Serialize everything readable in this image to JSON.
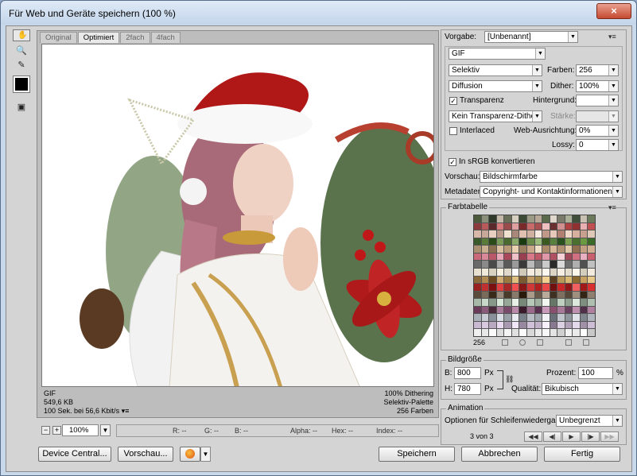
{
  "window": {
    "title": "Für Web und Geräte speichern (100 %)",
    "close_glyph": "×"
  },
  "tools": [
    {
      "name": "hand-tool-icon",
      "glyph": "✋",
      "selected": true
    },
    {
      "name": "slice-select-tool-icon",
      "glyph": "⤡",
      "selected": false
    },
    {
      "name": "zoom-tool-icon",
      "glyph": "🔍",
      "selected": false
    },
    {
      "name": "eyedropper-tool-icon",
      "glyph": "✎",
      "selected": false
    },
    {
      "name": "toggle-slices-icon",
      "glyph": "▣",
      "selected": false
    }
  ],
  "eyedropper_color": "#000000",
  "preview": {
    "tabs": [
      "Original",
      "Optimiert",
      "2fach",
      "4fach"
    ],
    "active_tab": 1,
    "info_left": [
      "GIF",
      "549,6 KB",
      "100 Sek. bei 56,6 Kbit/s"
    ],
    "info_menu_glyph": "▾≡",
    "info_right": [
      "100% Dithering",
      "Selektiv-Palette",
      "256 Farben"
    ]
  },
  "status": {
    "zoom_minus": "−",
    "zoom_plus": "+",
    "zoom": "100%",
    "readouts": [
      "R: --",
      "G: --",
      "B: --",
      "Alpha: --",
      "Hex: --",
      "Index: --"
    ]
  },
  "buttons": {
    "device_central": "Device Central...",
    "preview": "Vorschau...",
    "save": "Speichern",
    "cancel": "Abbrechen",
    "done": "Fertig"
  },
  "settings": {
    "preset_label": "Vorgabe:",
    "preset_value": "[Unbenannt]",
    "format": "GIF",
    "reduction": "Selektiv",
    "colors_label": "Farben:",
    "colors": "256",
    "dither_algo": "Diffusion",
    "dither_label": "Dither:",
    "dither": "100%",
    "transparency_label": "Transparenz",
    "transparency_checked": true,
    "matte_label": "Hintergrund:",
    "matte_value": "",
    "transparency_dither": "Kein Transparenz-Dither",
    "amount_label": "Stärke:",
    "amount_value": "",
    "interlaced_label": "Interlaced",
    "interlaced_checked": false,
    "websnap_label": "Web-Ausrichtung:",
    "websnap": "0%",
    "lossy_label": "Lossy:",
    "lossy": "0",
    "srgb_label": "In sRGB konvertieren",
    "srgb_checked": true,
    "preview_label": "Vorschau:",
    "preview_value": "Bildschirmfarbe",
    "metadata_label": "Metadaten:",
    "metadata_value": "Copyright- und Kontaktinformationen"
  },
  "color_table": {
    "title": "Farbtabelle",
    "count": "256",
    "colors": [
      "#4a5a3a",
      "#8a8f7a",
      "#2f3a2a",
      "#c4b8a8",
      "#6a6f5a",
      "#d8d0c0",
      "#3a4a35",
      "#9a9a85",
      "#b8a898",
      "#5a6a4a",
      "#e0d8cc",
      "#7a7a6a",
      "#a8b098",
      "#3f4f3a",
      "#c8c0b0",
      "#6a7a5a",
      "#8a3a3a",
      "#b85a5a",
      "#5a2a2a",
      "#d87a7a",
      "#9a4a4a",
      "#e0a0a0",
      "#7a2a2a",
      "#c86a6a",
      "#a85050",
      "#f0c0c0",
      "#6a3030",
      "#d09090",
      "#b04040",
      "#903030",
      "#e8b0b0",
      "#c05050",
      "#d8b8a8",
      "#c8a898",
      "#e8d0c0",
      "#b89888",
      "#f0e0d0",
      "#a88878",
      "#e0c0b0",
      "#d0b0a0",
      "#f8e8e0",
      "#c09888",
      "#e8c8b8",
      "#b08070",
      "#f0d8c8",
      "#d8b0a0",
      "#c8a090",
      "#e0c8b8",
      "#3a5a2a",
      "#5a7a3a",
      "#2a4a1a",
      "#7a9a5a",
      "#4a6a30",
      "#8aaa6a",
      "#1a3a10",
      "#6a8a4a",
      "#9aba7a",
      "#3a5a20",
      "#5a8040",
      "#2a5020",
      "#7aa050",
      "#4a7030",
      "#6a9a40",
      "#3a6a28",
      "#a89070",
      "#c8b090",
      "#8a7050",
      "#d8c0a0",
      "#b89a78",
      "#e8d0b0",
      "#9a8060",
      "#c8a888",
      "#f0e0c8",
      "#a88a68",
      "#d8b898",
      "#b09070",
      "#e0c8a8",
      "#907050",
      "#c0a080",
      "#d0b090",
      "#c86878",
      "#d88898",
      "#b85868",
      "#e8a8b8",
      "#a84858",
      "#f0c0c8",
      "#984050",
      "#d87888",
      "#c05868",
      "#e098a8",
      "#b05060",
      "#f8d0d8",
      "#a04858",
      "#d07080",
      "#e8b0c0",
      "#c86070",
      "#6a6a6a",
      "#8a8a8a",
      "#4a4a4a",
      "#aaaaaa",
      "#5a5a5a",
      "#9a9a9a",
      "#3a3a3a",
      "#bababa",
      "#7a7a7a",
      "#cacaca",
      "#2a2a2a",
      "#dadada",
      "#6f6f6f",
      "#afafaf",
      "#505050",
      "#c0c0c0",
      "#e8e0d0",
      "#f0e8d8",
      "#d8d0c0",
      "#f8f0e0",
      "#e0d8c8",
      "#ffffff",
      "#d0c8b8",
      "#f4ece0",
      "#ece4d4",
      "#fcf8f0",
      "#dcd4c4",
      "#f6eee2",
      "#e4dccc",
      "#faf6ec",
      "#d4ccbc",
      "#f2eadc",
      "#8a6a3a",
      "#b08a50",
      "#6a4a20",
      "#d0aa70",
      "#9a7a40",
      "#e0c080",
      "#7a5a30",
      "#c09a60",
      "#a8884a",
      "#f0d090",
      "#5a4020",
      "#b89858",
      "#d8b870",
      "#8a6a30",
      "#c8a060",
      "#e8c888",
      "#9a2020",
      "#c03030",
      "#7a1010",
      "#e04040",
      "#a82828",
      "#f05050",
      "#881818",
      "#d03838",
      "#b02020",
      "#e84848",
      "#701010",
      "#c82828",
      "#901818",
      "#f06060",
      "#a01818",
      "#d83030",
      "#5a4a3a",
      "#7a6a5a",
      "#3a2a1a",
      "#9a8a7a",
      "#4a3a2a",
      "#8a7a6a",
      "#2a1a0a",
      "#aa9a8a",
      "#6a5a4a",
      "#baaa9a",
      "#403020",
      "#7f6f5f",
      "#584838",
      "#9f8f7f",
      "#342414",
      "#8f7f6f",
      "#a8b8a8",
      "#c8d8c8",
      "#889888",
      "#d8e8d8",
      "#98a898",
      "#e8f0e8",
      "#788878",
      "#b8c8b8",
      "#a0b0a0",
      "#f0f8f0",
      "#687868",
      "#c0d0c0",
      "#90a090",
      "#dce8dc",
      "#809080",
      "#b0c0b0",
      "#6a3a5a",
      "#8a5a7a",
      "#4a2a3a",
      "#aa7a9a",
      "#7a4a6a",
      "#ba8aaa",
      "#3a1a2a",
      "#9a6a8a",
      "#5a3050",
      "#ca9aba",
      "#8a5070",
      "#a87898",
      "#6a4060",
      "#c090b0",
      "#503048",
      "#b080a0",
      "#aab0b8",
      "#c8ccd4",
      "#8a909a",
      "#d8dce4",
      "#9aa0a8",
      "#e8ecf0",
      "#7a808a",
      "#b8bcc4",
      "#a0a6ae",
      "#f0f2f6",
      "#6a707a",
      "#c0c4cc",
      "#90969e",
      "#dfe2e8",
      "#80868e",
      "#b0b4bc",
      "#c8b8d0",
      "#d8c8e0",
      "#b8a8c0",
      "#e8d8f0",
      "#a898b0",
      "#f0e8f8",
      "#9888a0",
      "#d0c0d8",
      "#c0b0c8",
      "#f8f0ff",
      "#887890",
      "#dcd0e4",
      "#b0a0b8",
      "#e4d8ec",
      "#a090a8",
      "#ccbcd4",
      "#f0f0f0",
      "#e8e8e8",
      "#fafafa",
      "#dcdcdc",
      "#f4f4f4",
      "#e0e0e0",
      "#fcfcfc",
      "#d8d8d8",
      "#ececec",
      "#f8f8f8",
      "#e4e4e4",
      "#d0d0d0",
      "#f2f2f2",
      "#eaeaea",
      "#ffffff",
      "#c8c8c8"
    ]
  },
  "image_size": {
    "title": "Bildgröße",
    "width_label": "B:",
    "width": "800",
    "width_unit": "Px",
    "height_label": "H:",
    "height": "780",
    "height_unit": "Px",
    "percent_label": "Prozent:",
    "percent": "100",
    "percent_unit": "%",
    "quality_label": "Qualität:",
    "quality": "Bikubisch"
  },
  "animation": {
    "title": "Animation",
    "loop_label": "Optionen für Schleifenwiedergabe:",
    "loop_value": "Unbegrenzt",
    "frame_counter": "3 von 3",
    "controls": [
      "◀◀",
      "◀|",
      "▶",
      "|▶",
      "▶▶"
    ]
  },
  "dropdown_glyph": "▼",
  "panel_menu_glyph": "▾≡",
  "check_glyph": "✓"
}
